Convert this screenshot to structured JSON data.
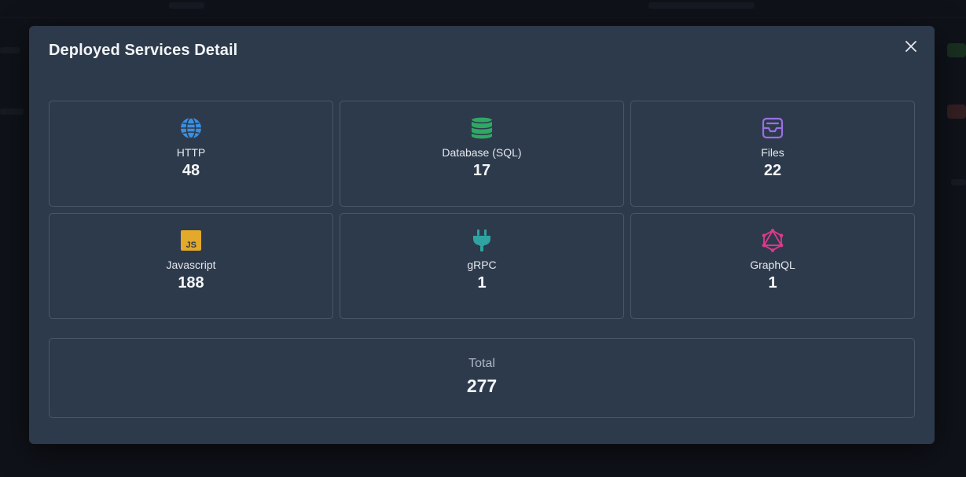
{
  "modal": {
    "title": "Deployed Services Detail",
    "close_icon": "close-icon"
  },
  "services": [
    {
      "label": "HTTP",
      "value": "48",
      "icon": "globe-icon",
      "color": "#3b8fe0"
    },
    {
      "label": "Database (SQL)",
      "value": "17",
      "icon": "database-icon",
      "color": "#2fa864"
    },
    {
      "label": "Files",
      "value": "22",
      "icon": "inbox-icon",
      "color": "#9a6fe4"
    },
    {
      "label": "Javascript",
      "value": "188",
      "icon": "javascript-icon",
      "color": "#e3a92a"
    },
    {
      "label": "gRPC",
      "value": "1",
      "icon": "plug-icon",
      "color": "#2fa3a0"
    },
    {
      "label": "GraphQL",
      "value": "1",
      "icon": "graphql-icon",
      "color": "#e0398c"
    }
  ],
  "total": {
    "label": "Total",
    "value": "277"
  },
  "colors": {
    "modal_bg": "#2d3a4b",
    "card_border": "#4a586b",
    "backdrop": "#14171e"
  }
}
